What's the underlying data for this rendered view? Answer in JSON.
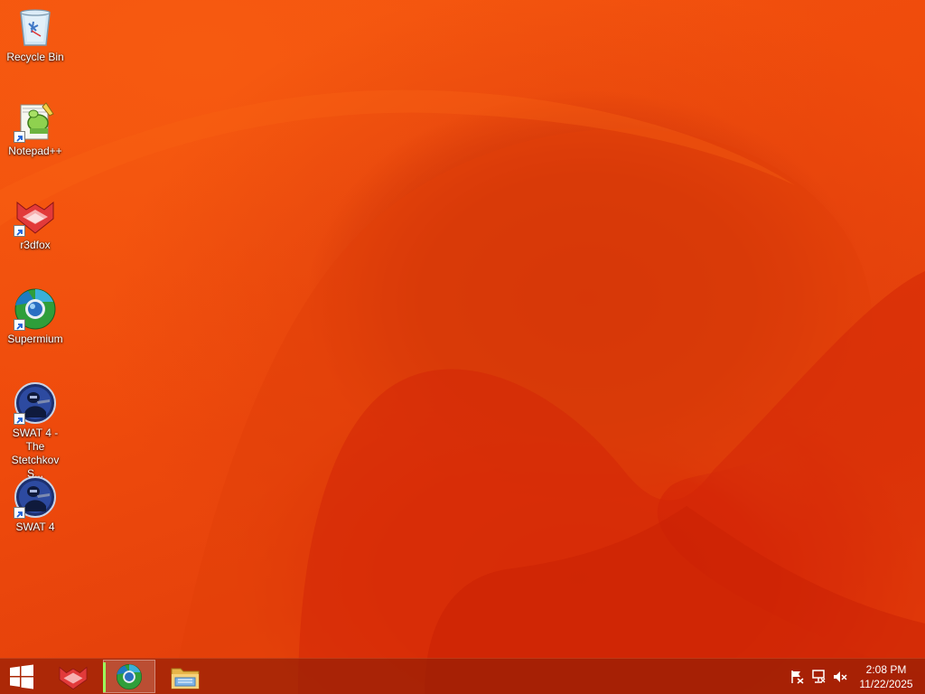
{
  "desktop": {
    "icons": [
      {
        "name": "recycle-bin",
        "label": "Recycle Bin",
        "icon": "recycle-bin-icon"
      },
      {
        "name": "notepad-plus-plus",
        "label": "Notepad++",
        "icon": "notepad-plus-plus-icon"
      },
      {
        "name": "r3dfox",
        "label": "r3dfox",
        "icon": "r3dfox-icon"
      },
      {
        "name": "supermium",
        "label": "Supermium",
        "icon": "supermium-icon"
      },
      {
        "name": "swat4-stetchkov",
        "label": "SWAT 4 - The Stetchkov S...",
        "icon": "swat4-icon"
      },
      {
        "name": "swat4",
        "label": "SWAT 4",
        "icon": "swat4-icon"
      }
    ]
  },
  "taskbar": {
    "start_icon": "windows-start-icon",
    "pinned": [
      {
        "name": "r3dfox",
        "icon": "r3dfox-icon",
        "active": false
      },
      {
        "name": "supermium",
        "icon": "supermium-icon",
        "active": true
      },
      {
        "name": "file-explorer",
        "icon": "folder-icon",
        "active": false
      }
    ],
    "tray": {
      "icons": [
        "action-center-flag-icon",
        "network-icon",
        "volume-muted-icon"
      ],
      "time": "2:08 PM",
      "date": "11/22/2025"
    }
  },
  "colors": {
    "wallpaper_base": "#f0500d",
    "wallpaper_deep": "#d12406",
    "taskbar": "#961e05",
    "active_indicator": "#9cff5a"
  }
}
